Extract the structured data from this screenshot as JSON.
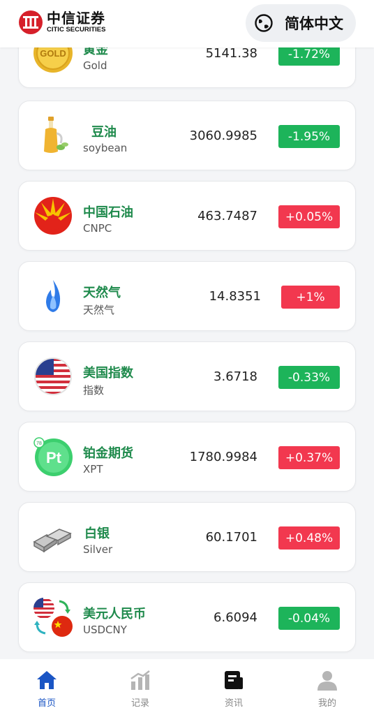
{
  "header": {
    "logo_cn": "中信证券",
    "logo_en": "CITIC SECURITIES",
    "lang_label": "简体中文"
  },
  "items": [
    {
      "name": "黄金",
      "sub": "Gold",
      "price": "5141.38",
      "change": "-1.72%",
      "dir": "down",
      "icon": "gold-coin-icon"
    },
    {
      "name": "豆油",
      "sub": "soybean",
      "price": "3060.9985",
      "change": "-1.95%",
      "dir": "down",
      "icon": "oil-bottle-icon"
    },
    {
      "name": "中国石油",
      "sub": "CNPC",
      "price": "463.7487",
      "change": "+0.05%",
      "dir": "up",
      "icon": "cnpc-logo-icon"
    },
    {
      "name": "天然气",
      "sub": "天然气",
      "price": "14.8351",
      "change": "+1%",
      "dir": "up",
      "icon": "gas-flame-icon"
    },
    {
      "name": "美国指数",
      "sub": "指数",
      "price": "3.6718",
      "change": "-0.33%",
      "dir": "down",
      "icon": "us-flag-icon"
    },
    {
      "name": "铂金期货",
      "sub": "XPT",
      "price": "1780.9984",
      "change": "+0.37%",
      "dir": "up",
      "icon": "platinum-element-icon"
    },
    {
      "name": "白银",
      "sub": "Silver",
      "price": "60.1701",
      "change": "+0.48%",
      "dir": "up",
      "icon": "silver-bars-icon"
    },
    {
      "name": "美元人民币",
      "sub": "USDCNY",
      "price": "6.6094",
      "change": "-0.04%",
      "dir": "down",
      "icon": "usd-cny-exchange-icon"
    }
  ],
  "tabs": [
    {
      "label": "首页",
      "icon": "home-icon",
      "active": true
    },
    {
      "label": "记录",
      "icon": "chart-bars-icon",
      "active": false
    },
    {
      "label": "资讯",
      "icon": "news-icon",
      "active": false
    },
    {
      "label": "我的",
      "icon": "user-icon",
      "active": false
    }
  ],
  "colors": {
    "down": "#1db45a",
    "up": "#f2384f",
    "name": "#1f8a4c",
    "active_tab": "#1a55c4"
  }
}
